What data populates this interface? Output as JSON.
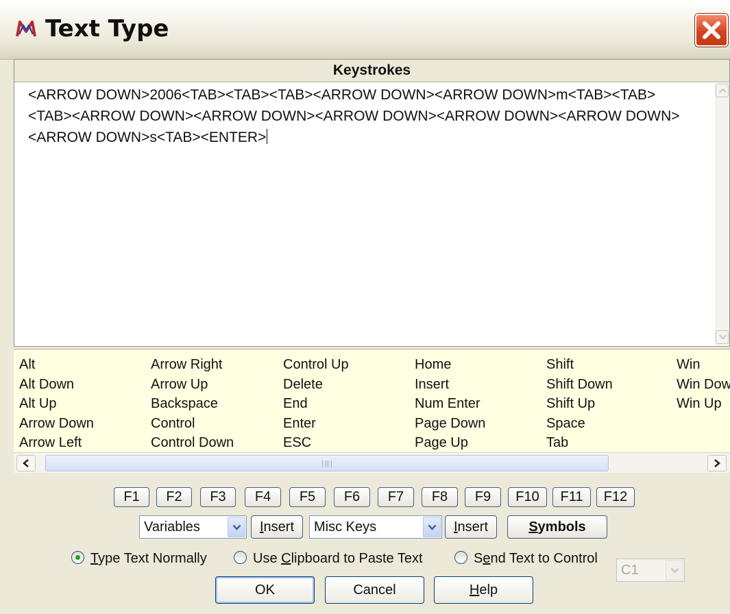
{
  "window": {
    "title": "Text Type"
  },
  "keystrokes": {
    "header": "Keystrokes",
    "value": "<ARROW DOWN>2006<TAB><TAB><TAB><ARROW DOWN><ARROW DOWN>m<TAB><TAB><TAB><ARROW DOWN><ARROW DOWN><ARROW DOWN><ARROW DOWN><ARROW DOWN><ARROW DOWN>s<TAB><ENTER>"
  },
  "key_list": {
    "columns": [
      [
        "Alt",
        "Alt Down",
        "Alt Up",
        "Arrow Down",
        "Arrow Left"
      ],
      [
        "Arrow Right",
        "Arrow Up",
        "Backspace",
        "Control",
        "Control Down"
      ],
      [
        "Control Up",
        "Delete",
        "End",
        "Enter",
        "ESC"
      ],
      [
        "Home",
        "Insert",
        "Num Enter",
        "Page Down",
        "Page Up"
      ],
      [
        "Shift",
        "Shift Down",
        "Shift Up",
        "Space",
        "Tab"
      ],
      [
        "Win",
        "Win Down",
        "Win Up"
      ]
    ]
  },
  "function_keys": [
    "F1",
    "F2",
    "F3",
    "F4",
    "F5",
    "F6",
    "F7",
    "F8",
    "F9",
    "F10",
    "F11",
    "F12"
  ],
  "variables": {
    "selected": "Variables",
    "insert_label_prefix": "",
    "insert_label_mnemonic": "I",
    "insert_label_rest": "nsert"
  },
  "misc_keys": {
    "selected": "Misc Keys",
    "insert_label_mnemonic": "I",
    "insert_label_rest": "nsert"
  },
  "symbols_button": {
    "mnemonic": "S",
    "rest": "ymbols"
  },
  "radios": {
    "type_normally": {
      "pre": "",
      "mnemonic": "T",
      "rest": "ype Text Normally",
      "checked": true
    },
    "clipboard": {
      "pre": "Use ",
      "mnemonic": "C",
      "rest": "lipboard to Paste Text",
      "checked": false
    },
    "send_to_control": {
      "pre": "S",
      "mnemonic": "e",
      "rest": "nd Text to Control",
      "checked": false
    }
  },
  "control_select": {
    "selected": "C1"
  },
  "buttons": {
    "ok": "OK",
    "cancel": "Cancel",
    "help_mnemonic": "H",
    "help_rest": "elp"
  },
  "colors": {
    "key_list_bg": "#ffffe1",
    "close_button": "#d9431f",
    "radio_checked": "#21a121"
  },
  "icons": {
    "app": "m-logo-icon",
    "close": "close-x-icon"
  }
}
